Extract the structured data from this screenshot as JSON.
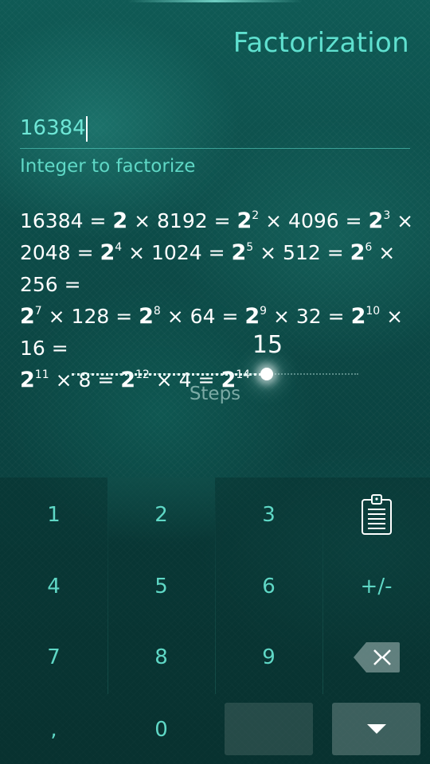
{
  "title": "Factorization",
  "input": {
    "value": "16384",
    "label": "Integer to factorize"
  },
  "result_lines": [
    [
      {
        "t": "16384 = "
      },
      {
        "b": "2"
      },
      {
        "t": " × 8192 = "
      },
      {
        "b": "2",
        "s": "2"
      },
      {
        "t": " × 4096 = "
      },
      {
        "b": "2",
        "s": "3"
      },
      {
        "t": " ×"
      }
    ],
    [
      {
        "t": "2048 = "
      },
      {
        "b": "2",
        "s": "4"
      },
      {
        "t": " × 1024 = "
      },
      {
        "b": "2",
        "s": "5"
      },
      {
        "t": " × 512 = "
      },
      {
        "b": "2",
        "s": "6"
      },
      {
        "t": " × 256 ="
      }
    ],
    [
      {
        "b": "2",
        "s": "7"
      },
      {
        "t": " × 128 = "
      },
      {
        "b": "2",
        "s": "8"
      },
      {
        "t": " × 64 = "
      },
      {
        "b": "2",
        "s": "9"
      },
      {
        "t": " × 32 = "
      },
      {
        "b": "2",
        "s": "10"
      },
      {
        "t": " × 16 ="
      }
    ],
    [
      {
        "b": "2",
        "s": "11"
      },
      {
        "t": " × 8 = "
      },
      {
        "b": "2",
        "s": "12"
      },
      {
        "t": " × 4 = "
      },
      {
        "b": "2",
        "s": "14"
      }
    ]
  ],
  "slider": {
    "value": "15",
    "label": "Steps",
    "fraction": 0.68
  },
  "keypad": {
    "keys": [
      "1",
      "2",
      "3",
      "4",
      "5",
      "+/-",
      "6",
      "7",
      "8",
      "9",
      ",",
      "0"
    ],
    "icons": {
      "paste": "clipboard-icon",
      "backspace": "backspace-icon",
      "close": "hide-keyboard-icon"
    }
  },
  "colors": {
    "accent": "#5fe0cf",
    "text": "#ffffff",
    "background": "#0c4a47"
  }
}
